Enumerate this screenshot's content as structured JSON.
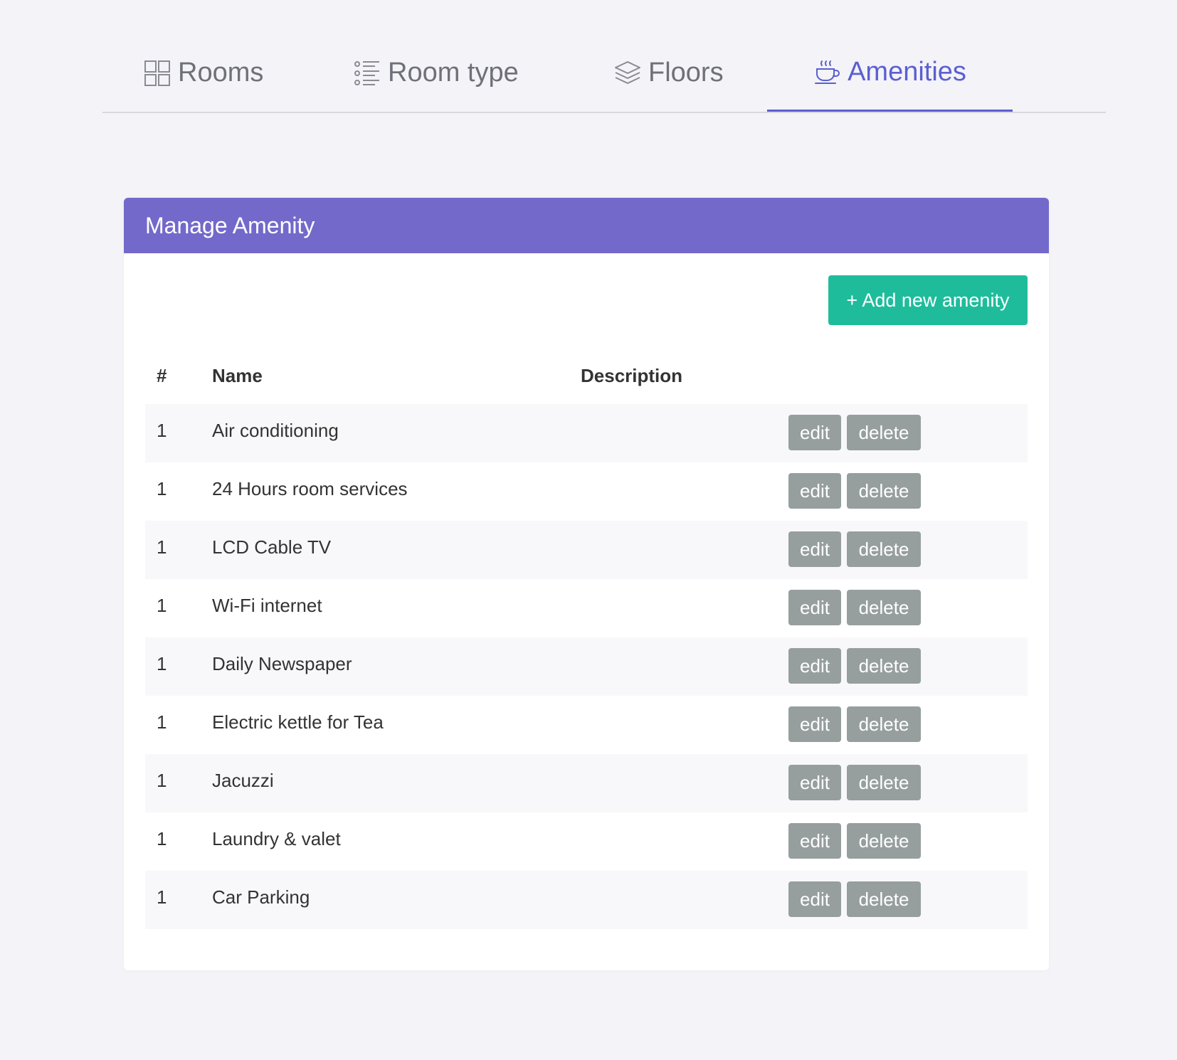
{
  "tabs": [
    {
      "label": "Rooms",
      "icon": "grid-icon",
      "active": false
    },
    {
      "label": "Room type",
      "icon": "list-icon",
      "active": false
    },
    {
      "label": "Floors",
      "icon": "layers-icon",
      "active": false
    },
    {
      "label": "Amenities",
      "icon": "coffee-cup-icon",
      "active": true
    }
  ],
  "card": {
    "title": "Manage Amenity",
    "add_button": "+ Add new amenity"
  },
  "table": {
    "columns": [
      "#",
      "Name",
      "Description"
    ],
    "edit_label": "edit",
    "delete_label": "delete",
    "rows": [
      {
        "num": "1",
        "name": "Air conditioning",
        "description": ""
      },
      {
        "num": "1",
        "name": "24 Hours room services",
        "description": ""
      },
      {
        "num": "1",
        "name": "LCD Cable TV",
        "description": ""
      },
      {
        "num": "1",
        "name": "Wi-Fi internet",
        "description": ""
      },
      {
        "num": "1",
        "name": "Daily Newspaper",
        "description": ""
      },
      {
        "num": "1",
        "name": "Electric kettle for Tea",
        "description": ""
      },
      {
        "num": "1",
        "name": "Jacuzzi",
        "description": ""
      },
      {
        "num": "1",
        "name": "Laundry & valet",
        "description": ""
      },
      {
        "num": "1",
        "name": "Car Parking",
        "description": ""
      }
    ]
  },
  "colors": {
    "accent": "#5b5fcf",
    "header": "#7369cb",
    "add_button": "#1fbc9c",
    "row_button": "#969e9e"
  }
}
